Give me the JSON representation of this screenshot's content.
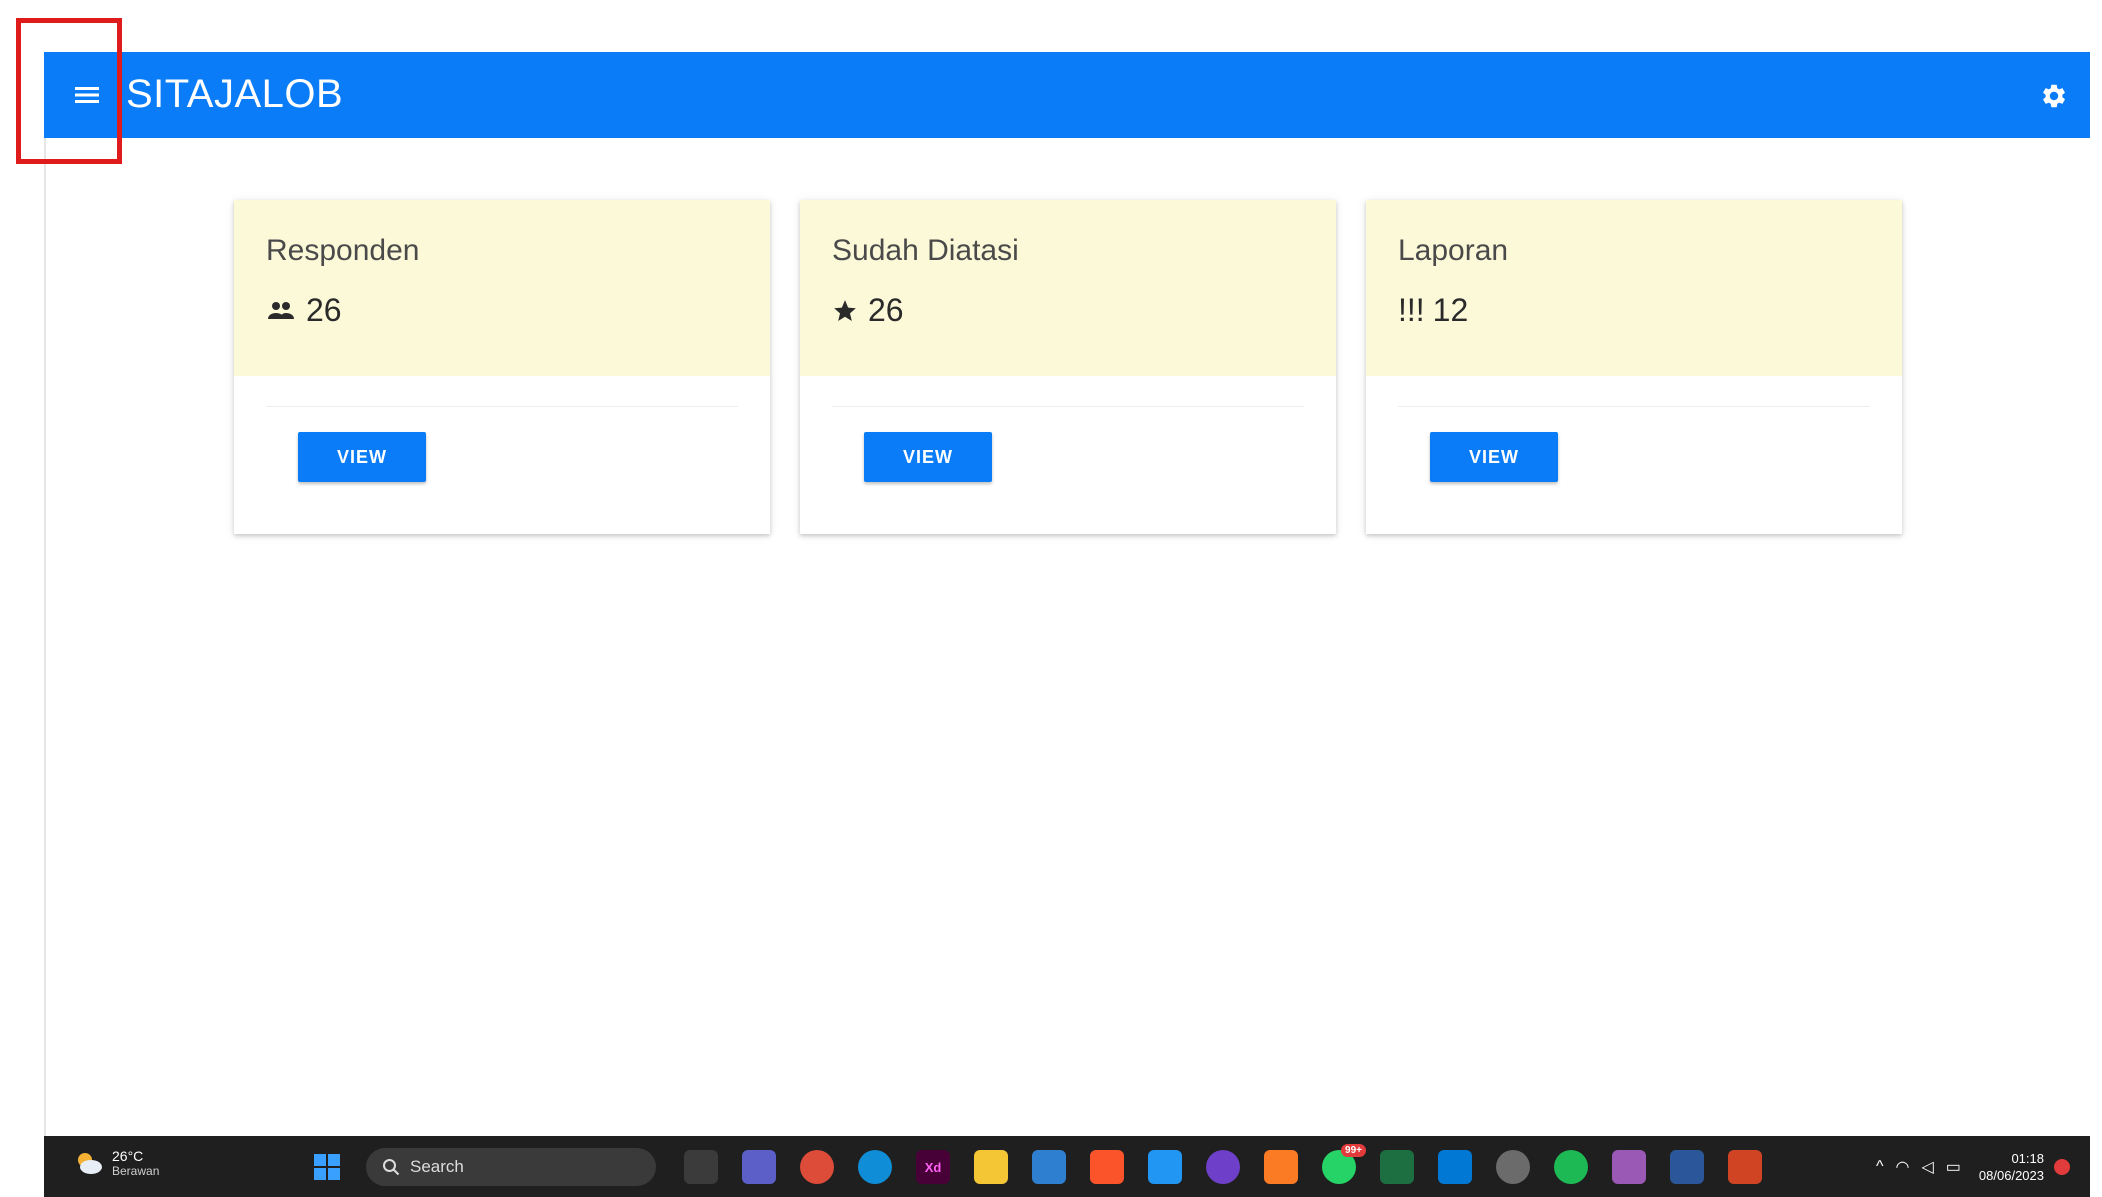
{
  "appbar": {
    "title": "SITAJALOB",
    "menu_icon": "hamburger-menu-icon",
    "settings_icon": "gear-icon",
    "color": "#0a7cf7"
  },
  "cards": [
    {
      "title": "Responden",
      "icon": "people-icon",
      "value": "26",
      "button": "VIEW"
    },
    {
      "title": "Sudah Diatasi",
      "icon": "star-icon",
      "value": "26",
      "button": "VIEW"
    },
    {
      "title": "Laporan",
      "icon": "exclamation-icon",
      "value": "12",
      "button": "VIEW",
      "icon_text": "!!!"
    }
  ],
  "card_header_color": "#fcf9d9",
  "taskbar": {
    "weather": {
      "temp": "26°C",
      "desc": "Berawan"
    },
    "search_label": "Search",
    "clock": {
      "time": "01:18",
      "date": "08/06/2023"
    },
    "whatsapp_badge": "99+"
  }
}
